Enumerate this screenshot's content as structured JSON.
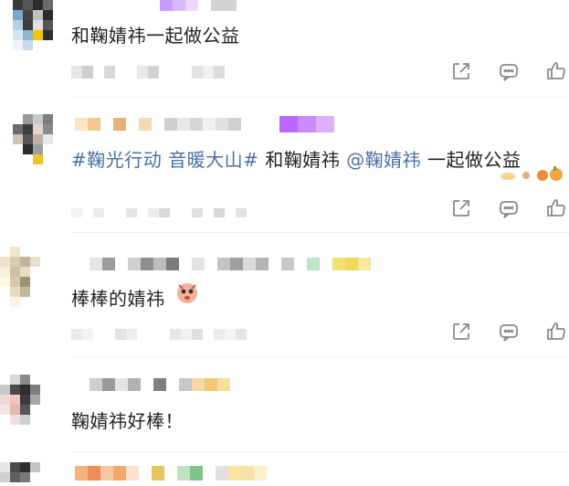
{
  "comments": [
    {
      "text": "和鞠婧祎一起做公益"
    },
    {
      "topic_tag": "#鞠光行动 音暖大山#",
      "text_mid": " 和鞠婧祎 ",
      "mention": "@鞠婧祎",
      "text_end": " 一起做公益"
    },
    {
      "text": "棒棒的婧祎"
    },
    {
      "text": "鞠婧祎好棒！"
    }
  ],
  "icons": {
    "share": "share-icon",
    "comment": "comment-icon",
    "like": "like-icon"
  },
  "colors": {
    "text": "#222222",
    "link": "#4a6fa5",
    "icon": "#8a8a8a",
    "vip_badge": "#c06bff"
  }
}
